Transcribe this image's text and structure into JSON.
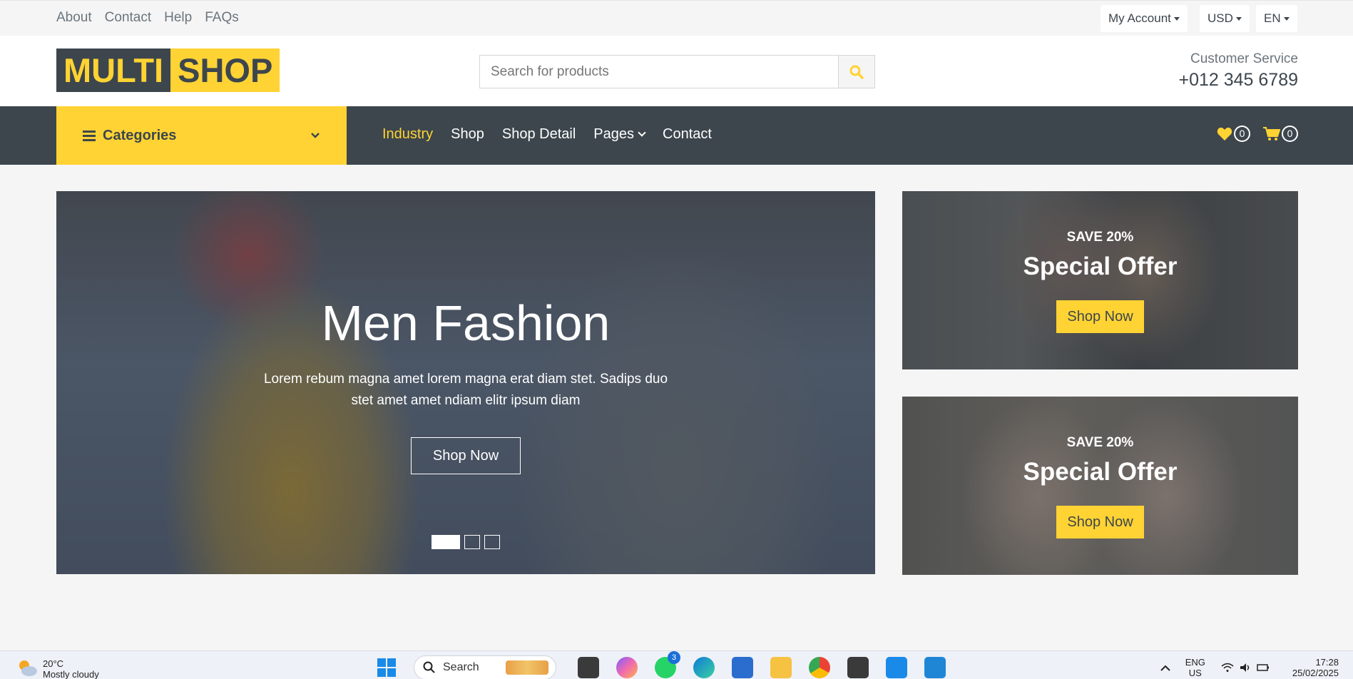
{
  "topbar": {
    "links": [
      "About",
      "Contact",
      "Help",
      "FAQs"
    ],
    "account": "My Account",
    "currency": "USD",
    "language": "EN"
  },
  "header": {
    "logo_part1": "MULTI",
    "logo_part2": "SHOP",
    "search_placeholder": "Search for products",
    "customer_service_label": "Customer Service",
    "phone": "+012 345 6789"
  },
  "nav": {
    "categories_label": "Categories",
    "links": [
      "Industry",
      "Shop",
      "Shop Detail",
      "Pages",
      "Contact"
    ],
    "active": "Industry",
    "wishlist_count": "0",
    "cart_count": "0"
  },
  "carousel": {
    "title": "Men Fashion",
    "text": "Lorem rebum magna amet lorem magna erat diam stet. Sadips duo stet amet amet ndiam elitr ipsum diam",
    "button": "Shop Now",
    "slides": 3,
    "active_slide": 1
  },
  "offers": [
    {
      "save": "SAVE 20%",
      "title": "Special Offer",
      "button": "Shop Now"
    },
    {
      "save": "SAVE 20%",
      "title": "Special Offer",
      "button": "Shop Now"
    }
  ],
  "taskbar": {
    "temperature": "20°C",
    "weather": "Mostly cloudy",
    "search_label": "Search",
    "whatsapp_badge": "3",
    "language_line1": "ENG",
    "language_line2": "US",
    "time": "17:28",
    "date": "25/02/2025"
  },
  "colors": {
    "accent": "#ffd333",
    "dark": "#3d464d",
    "background": "#f5f5f5"
  }
}
